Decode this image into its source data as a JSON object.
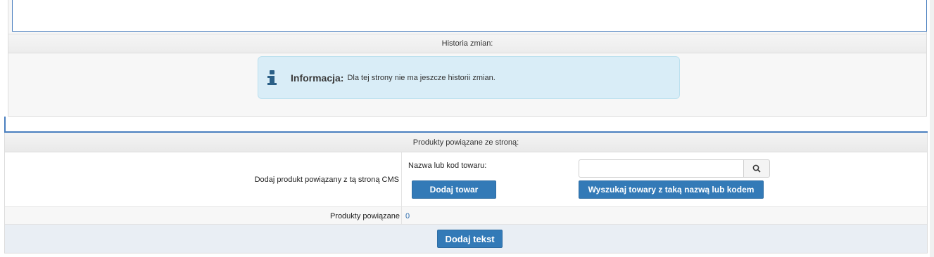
{
  "history": {
    "header": "Historia zmian:",
    "alert": {
      "icon": "info-icon",
      "title": "Informacja:",
      "message": "Dla tej strony nie ma jeszcze historii zmian."
    }
  },
  "products": {
    "header": "Produkty powiązane ze stroną:",
    "add_row": {
      "label": "Dodaj produkt powiązany z tą stroną CMS",
      "field_label": "Nazwa lub kod towaru:",
      "search_value": "",
      "search_icon": "search-icon",
      "add_button": "Dodaj towar",
      "search_button": "Wyszukaj towary z taką nazwą lub kodem"
    },
    "linked_row": {
      "label": "Produkty powiązane",
      "count": "0"
    }
  },
  "footer": {
    "add_text_button": "Dodaj tekst"
  },
  "colors": {
    "primary": "#337ab7",
    "alert_bg": "#d9edf7",
    "accent_line": "#4a7fbf",
    "link": "#2a6aad"
  }
}
